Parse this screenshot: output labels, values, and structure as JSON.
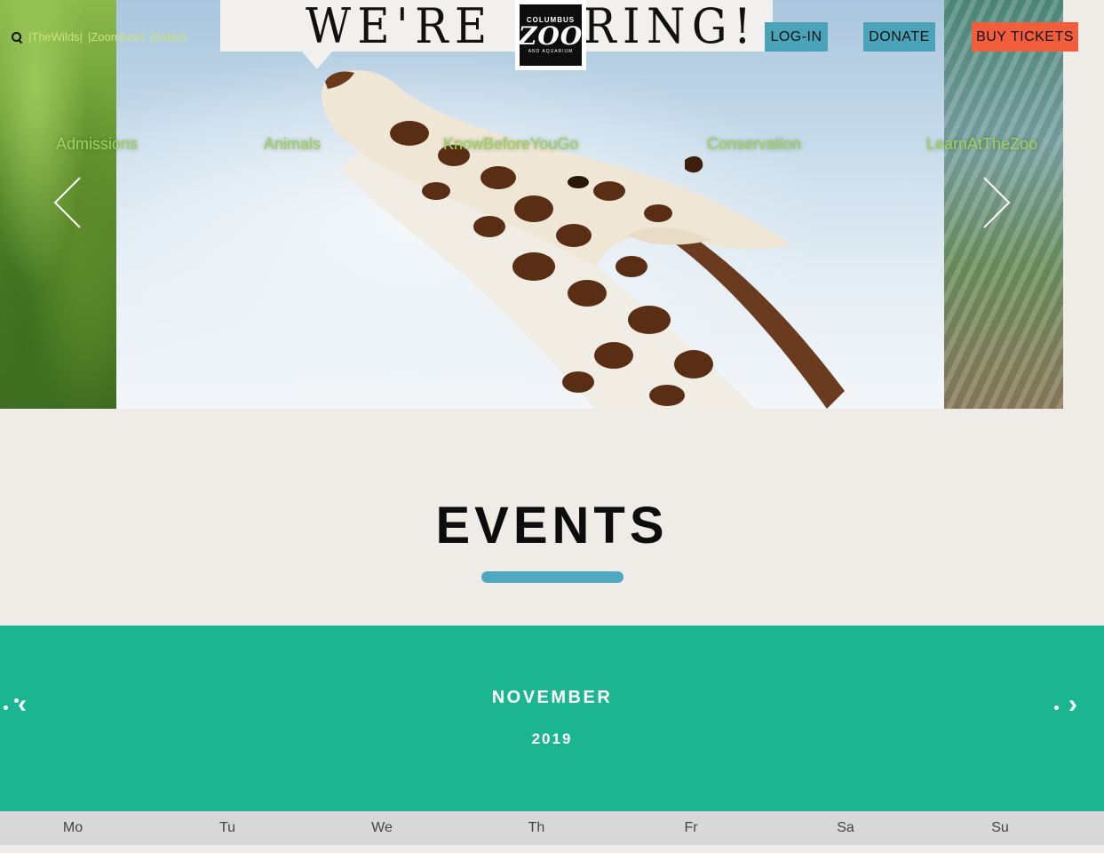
{
  "header": {
    "banner_text": "WE'RE HIRING!",
    "logo": {
      "top": "COLUMBUS",
      "main": "ZOO",
      "bottom": "AND AQUARIUM"
    },
    "top_links": [
      "|TheWilds|",
      "|Zoombezi|",
      "|Safari|"
    ],
    "buttons": {
      "login": "LOG-IN",
      "donate": "DONATE",
      "tickets": "BUY TICKETS"
    },
    "colors": {
      "login": "#4aa3b8",
      "donate": "#4aa3b8",
      "tickets": "#f25d3c"
    }
  },
  "nav": {
    "items": [
      "Admissions",
      "Animals",
      "KnowBeforeYouGo",
      "Conservation",
      "LearnAtTheZoo"
    ],
    "color": "#9fd066"
  },
  "carousel": {
    "prev_icon": "chevron-left-icon",
    "next_icon": "chevron-right-icon"
  },
  "events": {
    "title": "EVENTS",
    "accent": "#4ea8c0"
  },
  "calendar": {
    "month": "NOVEMBER",
    "year": "2019",
    "prev_label": "‹",
    "next_label": "›",
    "background": "#1bb591",
    "weekdays": [
      "Mo",
      "Tu",
      "We",
      "Th",
      "Fr",
      "Sa",
      "Su"
    ]
  }
}
